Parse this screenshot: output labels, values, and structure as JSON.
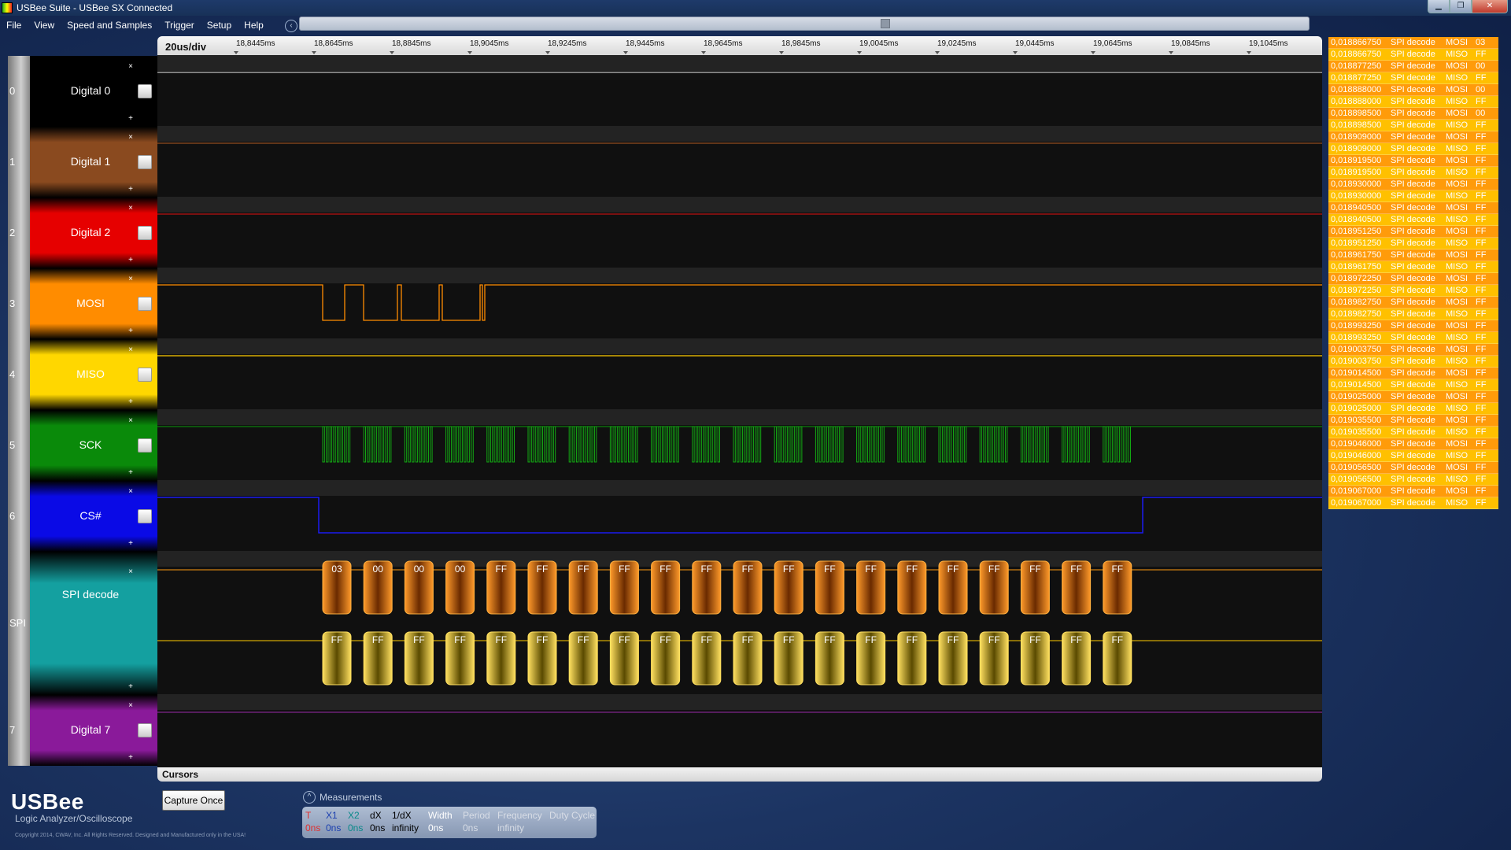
{
  "window": {
    "title": "USBee Suite - USBee SX Connected",
    "min": "▁",
    "max": "❐",
    "close": "✕"
  },
  "menu": [
    "File",
    "View",
    "Speed and Samples",
    "Trigger",
    "Setup",
    "Help"
  ],
  "scroll_icon": "‹",
  "timebar": {
    "div": "20us/div",
    "ticks": [
      "18,8445ms",
      "18,8645ms",
      "18,8845ms",
      "18,9045ms",
      "18,9245ms",
      "18,9445ms",
      "18,9645ms",
      "18,9845ms",
      "19,0045ms",
      "19,0245ms",
      "19,0445ms",
      "19,0645ms",
      "19,0845ms",
      "19,1045ms"
    ]
  },
  "channels": [
    {
      "num": "0",
      "name": "Digital 0",
      "color": "#000000"
    },
    {
      "num": "1",
      "name": "Digital 1",
      "color": "#8a4a1f"
    },
    {
      "num": "2",
      "name": "Digital 2",
      "color": "#e60000"
    },
    {
      "num": "3",
      "name": "MOSI",
      "color": "#ff8c00"
    },
    {
      "num": "4",
      "name": "MISO",
      "color": "#ffd700"
    },
    {
      "num": "5",
      "name": "SCK",
      "color": "#0a8a0a"
    },
    {
      "num": "6",
      "name": "CS#",
      "color": "#0a0ae6"
    },
    {
      "num": "SPI",
      "name": "SPI decode",
      "color": "#14a0a0"
    },
    {
      "num": "7",
      "name": "Digital 7",
      "color": "#8a1a9a"
    }
  ],
  "channel_controls": {
    "close": "×",
    "expand": "+"
  },
  "spi_bytes": {
    "mosi": [
      "03",
      "00",
      "00",
      "00",
      "FF",
      "FF",
      "FF",
      "FF",
      "FF",
      "FF",
      "FF",
      "FF",
      "FF",
      "FF",
      "FF",
      "FF",
      "FF",
      "FF",
      "FF",
      "FF"
    ],
    "miso": [
      "FF",
      "FF",
      "FF",
      "FF",
      "FF",
      "FF",
      "FF",
      "FF",
      "FF",
      "FF",
      "FF",
      "FF",
      "FF",
      "FF",
      "FF",
      "FF",
      "FF",
      "FF",
      "FF",
      "FF"
    ]
  },
  "decode_rows": [
    [
      "0,018866750",
      "SPI decode",
      "MOSI",
      "03"
    ],
    [
      "0,018866750",
      "SPI decode",
      "MISO",
      "FF"
    ],
    [
      "0,018877250",
      "SPI decode",
      "MOSI",
      "00"
    ],
    [
      "0,018877250",
      "SPI decode",
      "MISO",
      "FF"
    ],
    [
      "0,018888000",
      "SPI decode",
      "MOSI",
      "00"
    ],
    [
      "0,018888000",
      "SPI decode",
      "MISO",
      "FF"
    ],
    [
      "0,018898500",
      "SPI decode",
      "MOSI",
      "00"
    ],
    [
      "0,018898500",
      "SPI decode",
      "MISO",
      "FF"
    ],
    [
      "0,018909000",
      "SPI decode",
      "MOSI",
      "FF"
    ],
    [
      "0,018909000",
      "SPI decode",
      "MISO",
      "FF"
    ],
    [
      "0,018919500",
      "SPI decode",
      "MOSI",
      "FF"
    ],
    [
      "0,018919500",
      "SPI decode",
      "MISO",
      "FF"
    ],
    [
      "0,018930000",
      "SPI decode",
      "MOSI",
      "FF"
    ],
    [
      "0,018930000",
      "SPI decode",
      "MISO",
      "FF"
    ],
    [
      "0,018940500",
      "SPI decode",
      "MOSI",
      "FF"
    ],
    [
      "0,018940500",
      "SPI decode",
      "MISO",
      "FF"
    ],
    [
      "0,018951250",
      "SPI decode",
      "MOSI",
      "FF"
    ],
    [
      "0,018951250",
      "SPI decode",
      "MISO",
      "FF"
    ],
    [
      "0,018961750",
      "SPI decode",
      "MOSI",
      "FF"
    ],
    [
      "0,018961750",
      "SPI decode",
      "MISO",
      "FF"
    ],
    [
      "0,018972250",
      "SPI decode",
      "MOSI",
      "FF"
    ],
    [
      "0,018972250",
      "SPI decode",
      "MISO",
      "FF"
    ],
    [
      "0,018982750",
      "SPI decode",
      "MOSI",
      "FF"
    ],
    [
      "0,018982750",
      "SPI decode",
      "MISO",
      "FF"
    ],
    [
      "0,018993250",
      "SPI decode",
      "MOSI",
      "FF"
    ],
    [
      "0,018993250",
      "SPI decode",
      "MISO",
      "FF"
    ],
    [
      "0,019003750",
      "SPI decode",
      "MOSI",
      "FF"
    ],
    [
      "0,019003750",
      "SPI decode",
      "MISO",
      "FF"
    ],
    [
      "0,019014500",
      "SPI decode",
      "MOSI",
      "FF"
    ],
    [
      "0,019014500",
      "SPI decode",
      "MISO",
      "FF"
    ],
    [
      "0,019025000",
      "SPI decode",
      "MOSI",
      "FF"
    ],
    [
      "0,019025000",
      "SPI decode",
      "MISO",
      "FF"
    ],
    [
      "0,019035500",
      "SPI decode",
      "MOSI",
      "FF"
    ],
    [
      "0,019035500",
      "SPI decode",
      "MISO",
      "FF"
    ],
    [
      "0,019046000",
      "SPI decode",
      "MOSI",
      "FF"
    ],
    [
      "0,019046000",
      "SPI decode",
      "MISO",
      "FF"
    ],
    [
      "0,019056500",
      "SPI decode",
      "MOSI",
      "FF"
    ],
    [
      "0,019056500",
      "SPI decode",
      "MISO",
      "FF"
    ],
    [
      "0,019067000",
      "SPI decode",
      "MOSI",
      "FF"
    ],
    [
      "0,019067000",
      "SPI decode",
      "MISO",
      "FF"
    ]
  ],
  "cursors_label": "Cursors",
  "capture_button": "Capture Once",
  "measurements": {
    "toggle": "^",
    "label": "Measurements",
    "columns": [
      {
        "h": "T",
        "v": "0ns",
        "hc": "#e03030",
        "vc": "#e03030"
      },
      {
        "h": "X1",
        "v": "0ns",
        "hc": "#1b3fb0",
        "vc": "#1b3fb0"
      },
      {
        "h": "X2",
        "v": "0ns",
        "hc": "#0a8a8a",
        "vc": "#0a8a8a"
      },
      {
        "h": "dX",
        "v": "0ns",
        "hc": "#000000",
        "vc": "#000000"
      },
      {
        "h": "1/dX",
        "v": "infinity",
        "hc": "#000000",
        "vc": "#000000"
      },
      {
        "h": "Width",
        "v": "0ns",
        "hc": "#ffffff",
        "vc": "#ffffff"
      },
      {
        "h": "Period",
        "v": "0ns",
        "hc": "#d8dde6",
        "vc": "#d8dde6"
      },
      {
        "h": "Frequency",
        "v": "infinity",
        "hc": "#d8dde6",
        "vc": "#d8dde6"
      },
      {
        "h": "Duty Cycle",
        "v": "",
        "hc": "#d8dde6",
        "vc": "#d8dde6"
      }
    ]
  },
  "brand": {
    "name": "USBee",
    "subtitle": "Logic Analyzer/Oscilloscope",
    "copyright": "Copyright 2014, CWAV, Inc. All Rights Reserved. Designed and Manufactured only in the USA!"
  }
}
